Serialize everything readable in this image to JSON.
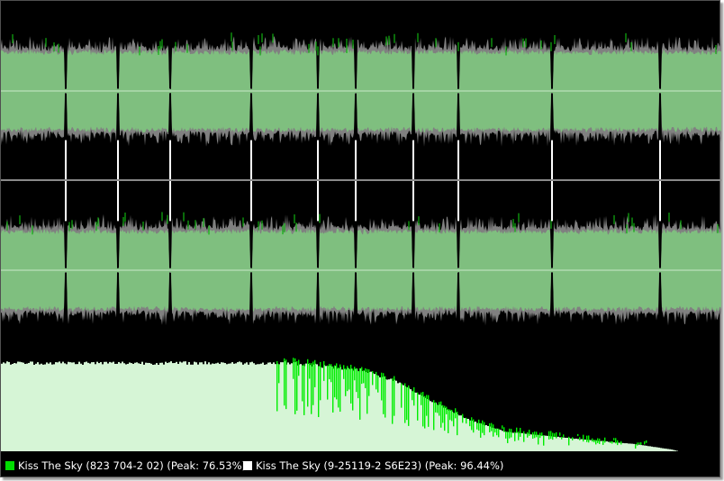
{
  "colors": {
    "background": "#000000",
    "wave_fill": "#7fbf7f",
    "wave_overshoot": "#808080",
    "wave_peak": "#10b010",
    "center_line": "#c8e8c8",
    "divider": "#8a8a8a",
    "marker": "#ffffff",
    "spectrum_fill": "#d6f5d6",
    "spectrum_peak": "#00ee00"
  },
  "legend": {
    "track1": {
      "label": "Kiss The Sky (823 704-2 02) (Peak: 76.53%)",
      "color": "#00dd00"
    },
    "track2": {
      "label": "Kiss The Sky (9-25119-2 S6E23) (Peak: 96.44%)",
      "color": "#ffffff"
    }
  },
  "waveform": {
    "track_gaps": [
      0.09,
      0.162,
      0.235,
      0.348,
      0.44,
      0.493,
      0.573,
      0.635,
      0.765,
      0.915
    ],
    "peak_track1": 0.7653,
    "peak_track2": 0.9644
  },
  "spectrum": {
    "profile": [
      [
        0.0,
        1.0
      ],
      [
        0.4,
        1.0
      ],
      [
        0.5,
        0.92
      ],
      [
        0.55,
        0.78
      ],
      [
        0.6,
        0.55
      ],
      [
        0.65,
        0.35
      ],
      [
        0.7,
        0.22
      ],
      [
        0.8,
        0.14
      ],
      [
        0.88,
        0.08
      ],
      [
        0.93,
        0.02
      ],
      [
        0.94,
        0.0
      ]
    ]
  }
}
